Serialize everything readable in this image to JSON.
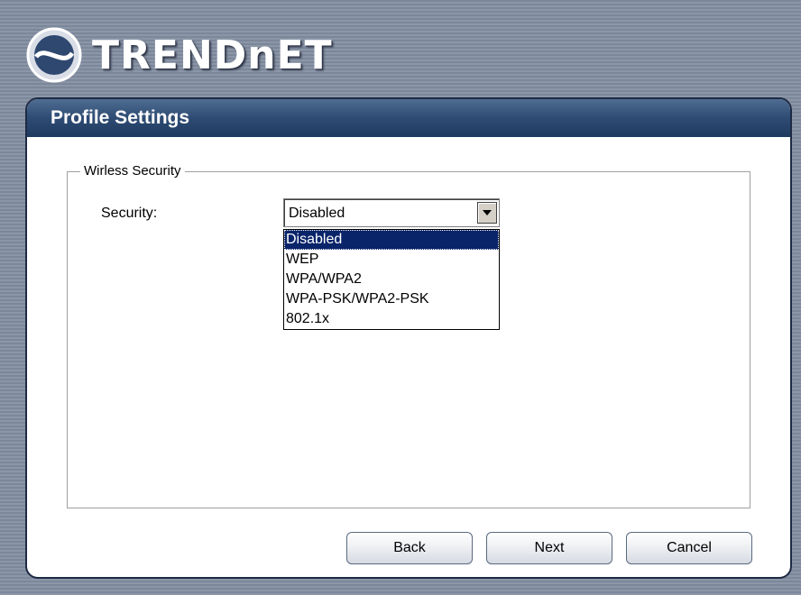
{
  "brand": {
    "logo_text": "TRENDnET"
  },
  "panel": {
    "title": "Profile Settings"
  },
  "group": {
    "legend": "Wirless Security"
  },
  "security": {
    "label": "Security:",
    "selected": "Disabled",
    "options": [
      "Disabled",
      "WEP",
      "WPA/WPA2",
      "WPA-PSK/WPA2-PSK",
      "802.1x"
    ]
  },
  "buttons": {
    "back": "Back",
    "next": "Next",
    "cancel": "Cancel"
  },
  "colors": {
    "header": "#2e4b73",
    "selection": "#0a246a",
    "background": "#8b96a8"
  }
}
